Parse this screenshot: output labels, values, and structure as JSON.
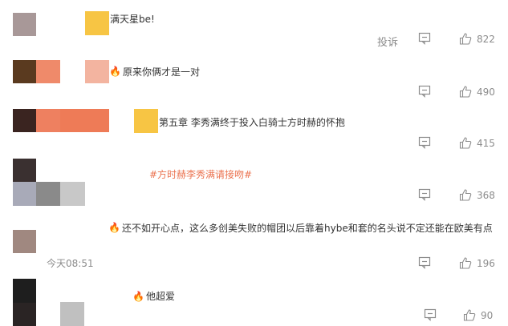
{
  "comments": [
    {
      "text": "满天星be!",
      "report": "投诉",
      "likes": "822"
    },
    {
      "text": "原来你俩才是一对",
      "likes": "490"
    },
    {
      "text": "第五章 李秀满终于投入白骑士方时赫的怀抱",
      "likes": "415"
    },
    {
      "text": "#方时赫李秀满请接吻#",
      "likes": "368"
    },
    {
      "text": "还不如开心点，这么多创美失败的帽团以后靠着hybe和套的名头说不定还能在欧美有点",
      "time": "今天08:51",
      "likes": "196"
    },
    {
      "text": "他超爱",
      "likes": "90"
    }
  ],
  "colors": {
    "hashtag": "#eb7350",
    "meta": "#8c8c8c",
    "yellow": "#f7c544",
    "orange": "#ee7b57",
    "peach": "#f3b4a0"
  },
  "icons": {
    "comment": "comment-icon",
    "like": "thumbs-up-icon",
    "badge": "flame-icon"
  }
}
